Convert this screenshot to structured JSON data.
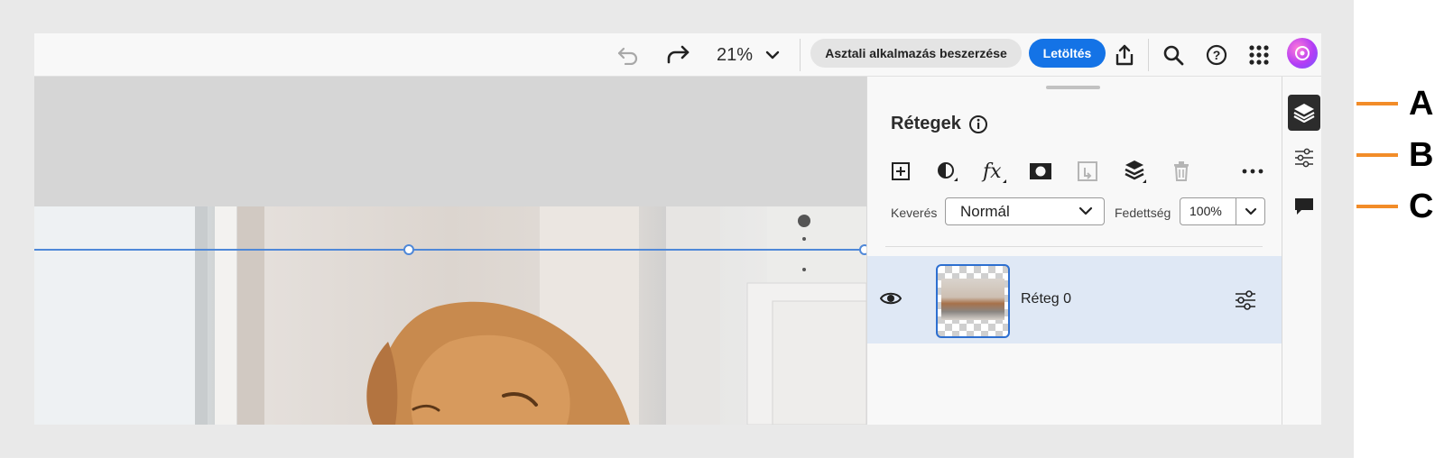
{
  "topbar": {
    "undo_icon": "undo-icon",
    "redo_icon": "redo-icon",
    "zoom_level": "21%",
    "desktop_app_label": "Asztali alkalmazás beszerzése",
    "download_label": "Letöltés",
    "share_icon": "share-icon",
    "search_icon": "search-icon",
    "help_icon": "help-icon",
    "apps_icon": "apps-grid-icon",
    "avatar_icon": "avatar-icon",
    "accent_color": "#1473e6"
  },
  "layers_panel": {
    "title": "Rétegek",
    "tools": [
      "add-layer-icon",
      "adjustment-icon",
      "fx-icon",
      "mask-icon",
      "clip-icon",
      "layer-stack-icon",
      "delete-icon",
      "more-icon"
    ],
    "blend_label": "Keverés",
    "blend_value": "Normál",
    "opacity_label": "Fedettség",
    "opacity_value": "100%",
    "layers": [
      {
        "name": "Réteg 0",
        "visible": true,
        "selected": true
      }
    ]
  },
  "right_rail": {
    "items": [
      {
        "icon": "layers-icon",
        "active": true
      },
      {
        "icon": "properties-icon",
        "active": false
      },
      {
        "icon": "comments-icon",
        "active": false
      }
    ]
  },
  "callouts": {
    "a": "A",
    "b": "B",
    "c": "C",
    "color": "#f28c28"
  }
}
